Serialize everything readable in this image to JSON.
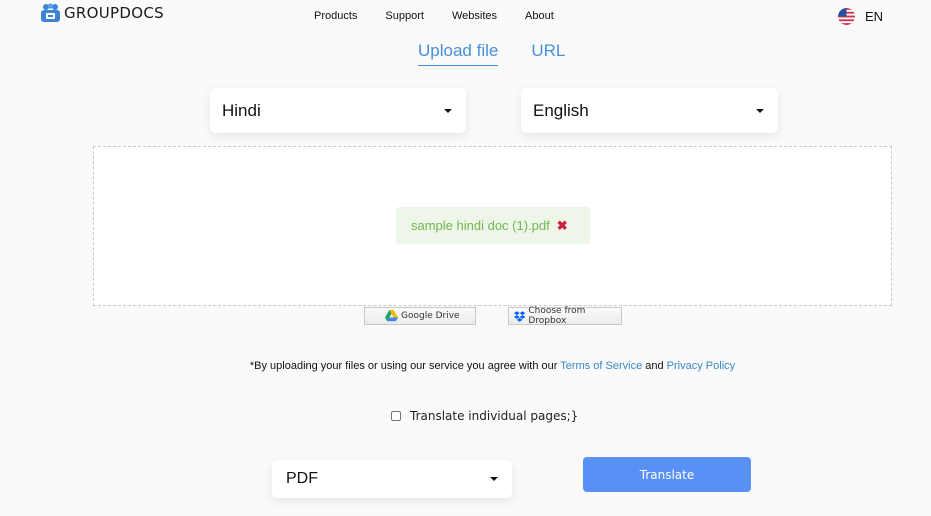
{
  "header": {
    "brand": "GROUPDOCS",
    "nav": [
      "Products",
      "Support",
      "Websites",
      "About"
    ],
    "language_code": "EN"
  },
  "tabs": [
    {
      "label": "Upload file",
      "active": true
    },
    {
      "label": "URL",
      "active": false
    }
  ],
  "source_language": "Hindi",
  "target_language": "English",
  "uploaded_file": {
    "name": "sample hindi doc (1).pdf",
    "remove_icon": "✖"
  },
  "cloud": {
    "google_drive": "Google Drive",
    "dropbox": "Choose from Dropbox"
  },
  "terms": {
    "prefix": "*By uploading your files or using our service you agree with our ",
    "tos": "Terms of Service",
    "and": " and ",
    "privacy": "Privacy Policy"
  },
  "options": {
    "individual_pages_label": "Translate individual pages;}",
    "individual_pages_checked": false
  },
  "output_format": "PDF",
  "translate_button": "Translate",
  "colors": {
    "accent": "#4a8fdb",
    "button": "#5890f5",
    "file_text": "#6fb84e",
    "remove": "#cc1f3a"
  }
}
